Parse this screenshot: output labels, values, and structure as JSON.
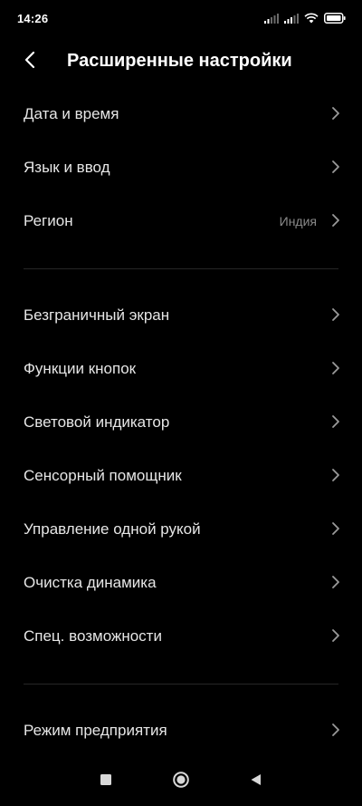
{
  "status": {
    "time": "14:26"
  },
  "header": {
    "title": "Расширенные настройки"
  },
  "sections": [
    {
      "items": [
        {
          "label": "Дата и время",
          "value": ""
        },
        {
          "label": "Язык и ввод",
          "value": ""
        },
        {
          "label": "Регион",
          "value": "Индия"
        }
      ]
    },
    {
      "items": [
        {
          "label": "Безграничный экран",
          "value": ""
        },
        {
          "label": "Функции кнопок",
          "value": ""
        },
        {
          "label": "Световой индикатор",
          "value": ""
        },
        {
          "label": "Сенсорный помощник",
          "value": ""
        },
        {
          "label": "Управление одной рукой",
          "value": ""
        },
        {
          "label": "Очистка динамика",
          "value": ""
        },
        {
          "label": "Спец. возможности",
          "value": ""
        }
      ]
    },
    {
      "items": [
        {
          "label": "Режим предприятия",
          "value": ""
        }
      ]
    }
  ],
  "icons": {
    "back": "chevron-left-icon",
    "chevron": "chevron-right-icon",
    "nav_recents": "square-icon",
    "nav_home": "circle-icon",
    "nav_back": "triangle-left-icon"
  },
  "colors": {
    "background": "#000000",
    "text": "#e6e6e6",
    "secondary_text": "#8a8a8a",
    "chevron": "#9a9a9a",
    "divider": "#262626"
  }
}
